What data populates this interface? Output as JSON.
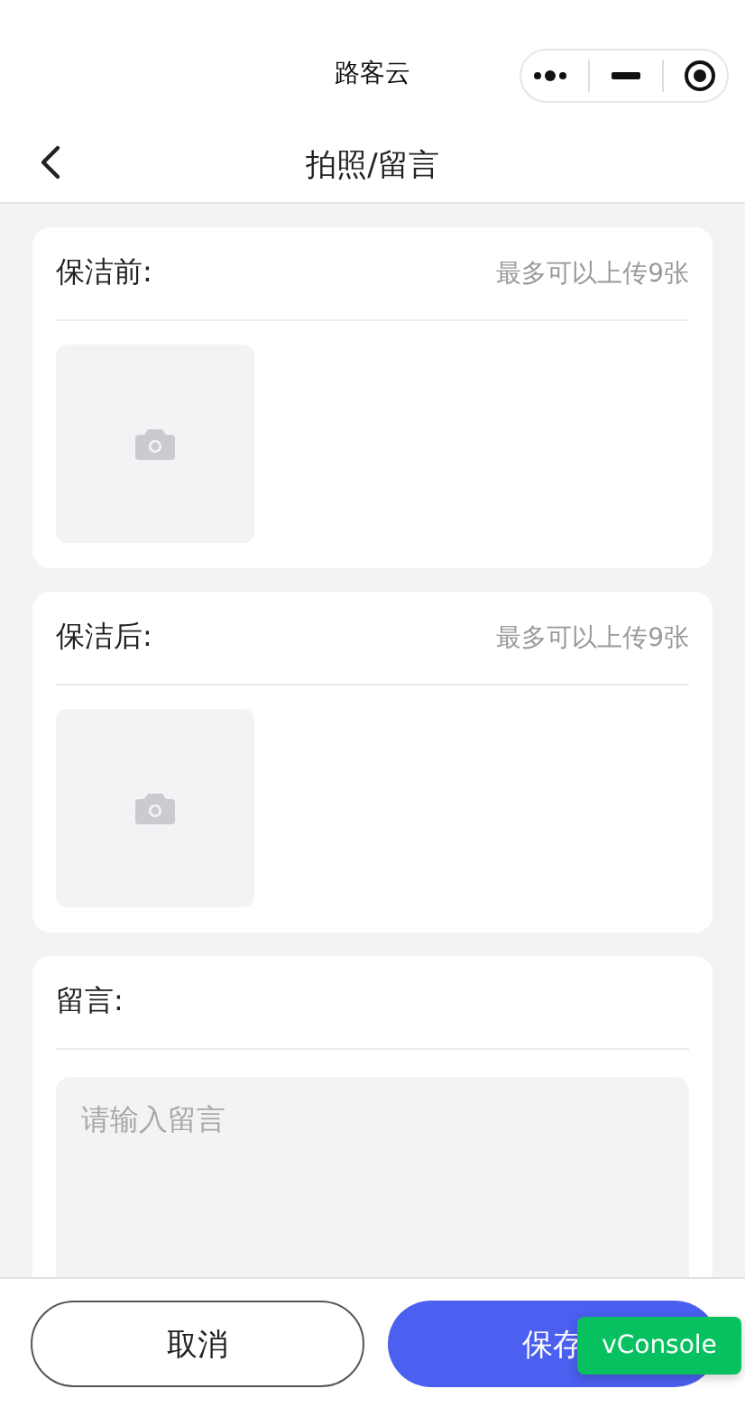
{
  "app_title": "路客云",
  "nav": {
    "title": "拍照/留言"
  },
  "sections": [
    {
      "kind": "upload",
      "title": "保洁前:",
      "hint": "最多可以上传9张"
    },
    {
      "kind": "upload",
      "title": "保洁后:",
      "hint": "最多可以上传9张"
    },
    {
      "kind": "message",
      "title": "留言:",
      "placeholder": "请输入留言"
    }
  ],
  "buttons": [
    {
      "kind": "secondary",
      "label": "取消"
    },
    {
      "kind": "primary",
      "label": "保存"
    }
  ],
  "debug_badge": "vConsole"
}
